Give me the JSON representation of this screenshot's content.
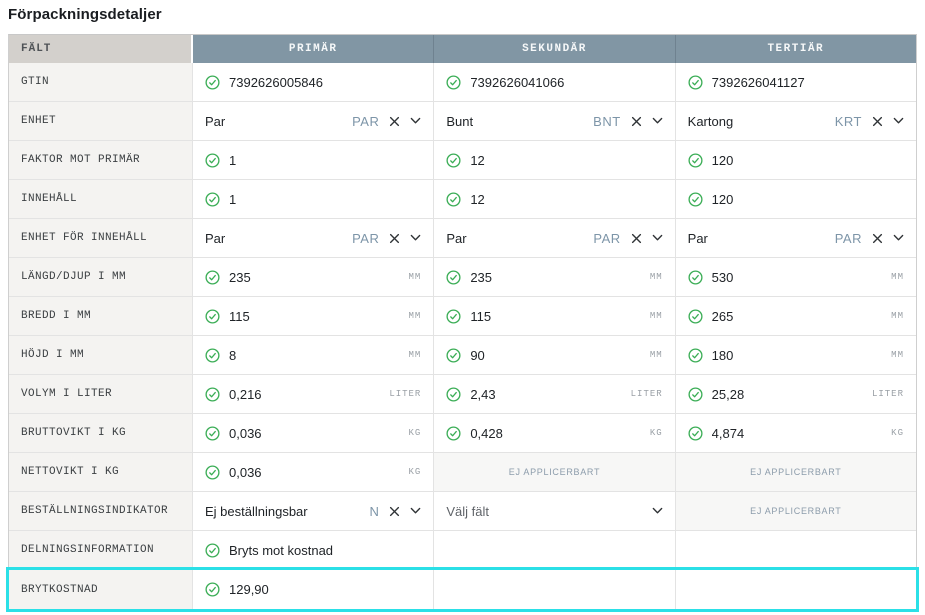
{
  "page_title": "Förpackningsdetaljer",
  "colors": {
    "header_bg": "#8196a4",
    "field_header_bg": "#d3d0cc",
    "field_cell_bg": "#f4f3f1",
    "check_green": "#3aad55",
    "unit_code_blue": "#7d95a8",
    "highlight_cyan": "#2be0e7",
    "na_text": "#8c9cab"
  },
  "table": {
    "headers": [
      {
        "key": "falt",
        "label": "FÄLT"
      },
      {
        "key": "primar",
        "label": "PRIMÄR"
      },
      {
        "key": "sekundar",
        "label": "SEKUNDÄR"
      },
      {
        "key": "tertiar",
        "label": "TERTIÄR"
      }
    ],
    "na_label": "EJ APPLICERBART",
    "rows": [
      {
        "label": "GTIN",
        "cells": [
          {
            "type": "value",
            "check": true,
            "text": "7392626005846"
          },
          {
            "type": "value",
            "check": true,
            "text": "7392626041066"
          },
          {
            "type": "value",
            "check": true,
            "text": "7392626041127"
          }
        ]
      },
      {
        "label": "ENHET",
        "cells": [
          {
            "type": "unit",
            "text": "Par",
            "code": "PAR"
          },
          {
            "type": "unit",
            "text": "Bunt",
            "code": "BNT"
          },
          {
            "type": "unit",
            "text": "Kartong",
            "code": "KRT"
          }
        ]
      },
      {
        "label": "FAKTOR MOT PRIMÄR",
        "cells": [
          {
            "type": "value",
            "check": true,
            "text": "1"
          },
          {
            "type": "value",
            "check": true,
            "text": "12"
          },
          {
            "type": "value",
            "check": true,
            "text": "120"
          }
        ]
      },
      {
        "label": "INNEHÅLL",
        "cells": [
          {
            "type": "value",
            "check": true,
            "text": "1"
          },
          {
            "type": "value",
            "check": true,
            "text": "12"
          },
          {
            "type": "value",
            "check": true,
            "text": "120"
          }
        ]
      },
      {
        "label": "ENHET FÖR INNEHÅLL",
        "cells": [
          {
            "type": "unit",
            "text": "Par",
            "code": "PAR"
          },
          {
            "type": "unit",
            "text": "Par",
            "code": "PAR"
          },
          {
            "type": "unit",
            "text": "Par",
            "code": "PAR"
          }
        ]
      },
      {
        "label": "LÄNGD/DJUP I MM",
        "cells": [
          {
            "type": "value",
            "check": true,
            "text": "235",
            "unit": "MM"
          },
          {
            "type": "value",
            "check": true,
            "text": "235",
            "unit": "MM"
          },
          {
            "type": "value",
            "check": true,
            "text": "530",
            "unit": "MM"
          }
        ]
      },
      {
        "label": "BREDD I MM",
        "cells": [
          {
            "type": "value",
            "check": true,
            "text": "115",
            "unit": "MM"
          },
          {
            "type": "value",
            "check": true,
            "text": "115",
            "unit": "MM"
          },
          {
            "type": "value",
            "check": true,
            "text": "265",
            "unit": "MM"
          }
        ]
      },
      {
        "label": "HÖJD I MM",
        "cells": [
          {
            "type": "value",
            "check": true,
            "text": "8",
            "unit": "MM"
          },
          {
            "type": "value",
            "check": true,
            "text": "90",
            "unit": "MM"
          },
          {
            "type": "value",
            "check": true,
            "text": "180",
            "unit": "MM"
          }
        ]
      },
      {
        "label": "VOLYM I LITER",
        "cells": [
          {
            "type": "value",
            "check": true,
            "text": "0,216",
            "unit": "LITER"
          },
          {
            "type": "value",
            "check": true,
            "text": "2,43",
            "unit": "LITER"
          },
          {
            "type": "value",
            "check": true,
            "text": "25,28",
            "unit": "LITER"
          }
        ]
      },
      {
        "label": "BRUTTOVIKT I KG",
        "cells": [
          {
            "type": "value",
            "check": true,
            "text": "0,036",
            "unit": "KG"
          },
          {
            "type": "value",
            "check": true,
            "text": "0,428",
            "unit": "KG"
          },
          {
            "type": "value",
            "check": true,
            "text": "4,874",
            "unit": "KG"
          }
        ]
      },
      {
        "label": "NETTOVIKT I KG",
        "cells": [
          {
            "type": "value",
            "check": true,
            "text": "0,036",
            "unit": "KG"
          },
          {
            "type": "na"
          },
          {
            "type": "na"
          }
        ]
      },
      {
        "label": "BESTÄLLNINGSINDIKATOR",
        "cells": [
          {
            "type": "unit",
            "text": "Ej beställningsbar",
            "code": "N"
          },
          {
            "type": "select",
            "text": "Välj fält"
          },
          {
            "type": "na"
          }
        ]
      },
      {
        "label": "DELNINGSINFORMATION",
        "cells": [
          {
            "type": "value",
            "check": true,
            "text": "Bryts mot kostnad"
          },
          {
            "type": "empty"
          },
          {
            "type": "empty"
          }
        ]
      },
      {
        "label": "BRYTKOSTNAD",
        "highlight": true,
        "cells": [
          {
            "type": "value",
            "check": true,
            "text": "129,90"
          },
          {
            "type": "empty"
          },
          {
            "type": "empty"
          }
        ]
      }
    ]
  }
}
